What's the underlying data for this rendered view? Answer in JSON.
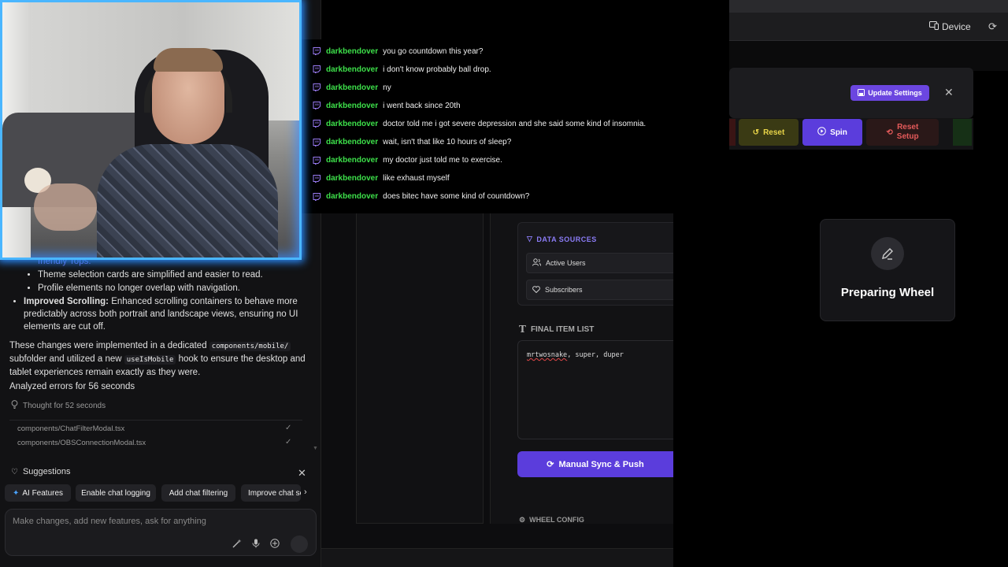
{
  "chat": {
    "messages": [
      {
        "user": "darkbendover",
        "text": "you go countdown this year?"
      },
      {
        "user": "darkbendover",
        "text": "i don't know probably ball drop."
      },
      {
        "user": "darkbendover",
        "text": "ny"
      },
      {
        "user": "darkbendover",
        "text": "i went back since 20th"
      },
      {
        "user": "darkbendover",
        "text": "doctor told me i got severe depression and she said some kind of insomnia."
      },
      {
        "user": "darkbendover",
        "text": "wait, isn't that like 10 hours of sleep?"
      },
      {
        "user": "darkbendover",
        "text": "my doctor just told me to exercise."
      },
      {
        "user": "darkbendover",
        "text": "like exhaust myself"
      },
      {
        "user": "darkbendover",
        "text": "does bitec have some kind of countdown?"
      }
    ],
    "user_color": "#3de04a"
  },
  "assistant": {
    "partial_line": "friendly Tops.",
    "sub_items": [
      "Theme selection cards are simplified and easier to read.",
      "Profile elements no longer overlap with navigation."
    ],
    "scroll_bold": "Improved Scrolling:",
    "scroll_text": " Enhanced scrolling containers to behave more predictably across both portrait and landscape views, ensuring no UI elements are cut off.",
    "p1_a": "These changes were implemented in a dedicated ",
    "p1_code1": "components/mobile/",
    "p1_b": " subfolder and utilized a new ",
    "p1_code2": "useIsMobile",
    "p1_c": " hook to ensure the desktop and tablet experiences remain exactly as they were.",
    "analyzed": "Analyzed errors for 56 seconds",
    "thought": "Thought for 52 seconds",
    "files": [
      "components/ChatFilterModal.tsx",
      "components/OBSConnectionModal.tsx"
    ]
  },
  "suggestions": {
    "title": "Suggestions",
    "chips": [
      "AI Features",
      "Enable chat logging",
      "Add chat filtering",
      "Improve chat se"
    ]
  },
  "input": {
    "placeholder": "Make changes, add new features, ask for anything"
  },
  "topbar": {
    "device_label": "Device"
  },
  "settings": {
    "update_label": "Update Settings",
    "reset_label": "Reset",
    "spin_label": "Spin",
    "reset_setup_line1": "Reset",
    "reset_setup_line2": "Setup"
  },
  "wheel": {
    "preparing": "Preparing Wheel"
  },
  "editor": {
    "data_sources_title": "DATA SOURCES",
    "sources": [
      "Active Users",
      "Subscribers"
    ],
    "final_list_title": "FINAL ITEM LIST",
    "final_list_first": "mrtwosnake",
    "final_list_rest": ", super, duper",
    "sync_label": "Manual Sync & Push",
    "wheel_config": "WHEEL CONFIG"
  },
  "colors": {
    "accent": "#5b3ddc",
    "webcam_border": "#4ab6ff"
  }
}
